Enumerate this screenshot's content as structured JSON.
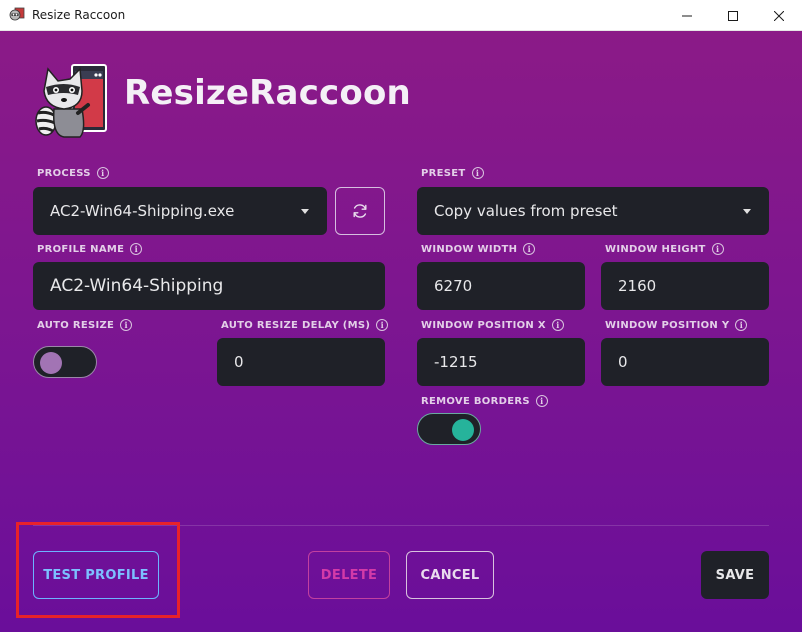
{
  "window": {
    "title": "Resize Raccoon"
  },
  "brand": {
    "name": "ResizeRaccoon"
  },
  "form": {
    "process": {
      "label": "PROCESS",
      "value": "AC2-Win64-Shipping.exe"
    },
    "preset": {
      "label": "PRESET",
      "value": "Copy values from preset"
    },
    "profile_name": {
      "label": "PROFILE NAME",
      "value": "AC2-Win64-Shipping"
    },
    "window_width": {
      "label": "WINDOW WIDTH",
      "value": "6270"
    },
    "window_height": {
      "label": "WINDOW HEIGHT",
      "value": "2160"
    },
    "auto_resize": {
      "label": "AUTO RESIZE",
      "enabled": false
    },
    "auto_resize_delay": {
      "label": "AUTO RESIZE DELAY (MS)",
      "value": "0"
    },
    "window_position_x": {
      "label": "WINDOW POSITION X",
      "value": "-1215"
    },
    "window_position_y": {
      "label": "WINDOW POSITION Y",
      "value": "0"
    },
    "remove_borders": {
      "label": "REMOVE BORDERS",
      "enabled": true
    }
  },
  "actions": {
    "test_profile": "TEST PROFILE",
    "delete": "DELETE",
    "cancel": "CANCEL",
    "save": "SAVE"
  },
  "colors": {
    "background_top": "#8b1a87",
    "background_bottom": "#6a0e9a",
    "field_bg": "#1f2128",
    "test_accent": "#7cc0ff",
    "delete_accent": "#d33aa8",
    "toggle_on": "#26b39b",
    "toggle_off": "#a274b4",
    "highlight": "#e8222a"
  },
  "icons": {
    "app": "raccoon-app-icon",
    "refresh": "refresh-icon",
    "info": "info-icon"
  }
}
